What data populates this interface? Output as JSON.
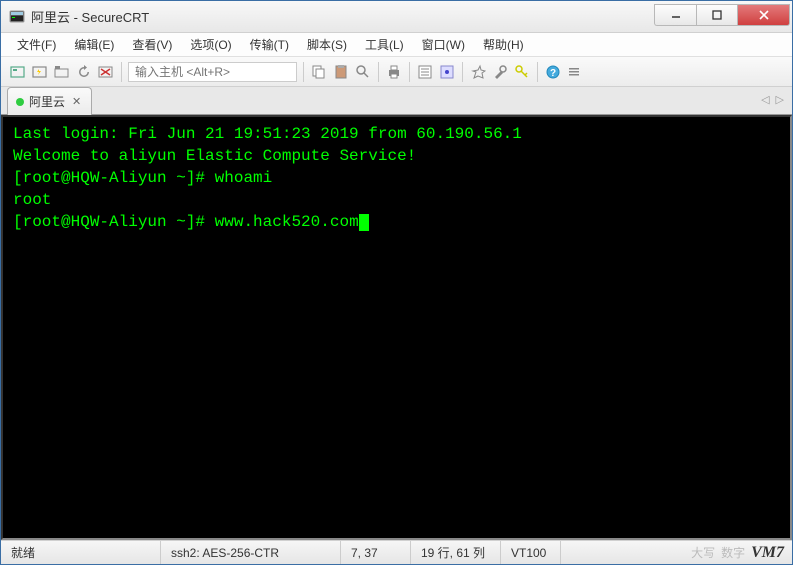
{
  "window": {
    "title": "阿里云 - SecureCRT"
  },
  "menu": {
    "file": "文件(F)",
    "edit": "编辑(E)",
    "view": "查看(V)",
    "options": "选项(O)",
    "transfer": "传输(T)",
    "script": "脚本(S)",
    "tools": "工具(L)",
    "window": "窗口(W)",
    "help": "帮助(H)"
  },
  "toolbar": {
    "host_placeholder": "输入主机 <Alt+R>"
  },
  "tab": {
    "label": "阿里云"
  },
  "terminal": {
    "line1": "Last login: Fri Jun 21 19:51:23 2019 from 60.190.56.1",
    "line2": "",
    "line3": "Welcome to aliyun Elastic Compute Service!",
    "line4": "",
    "prompt1": "[root@HQW-Aliyun ~]# ",
    "cmd1": "whoami",
    "output1": "root",
    "prompt2": "[root@HQW-Aliyun ~]# ",
    "cmd2": "www.hack520.com"
  },
  "status": {
    "ready": "就绪",
    "protocol": "ssh2: AES-256-CTR",
    "cursor_pos": "7,  37",
    "size": "19 行, 61 列",
    "term_type": "VT100",
    "caps": "大写",
    "numlock": "数字",
    "vm": "VM7"
  }
}
